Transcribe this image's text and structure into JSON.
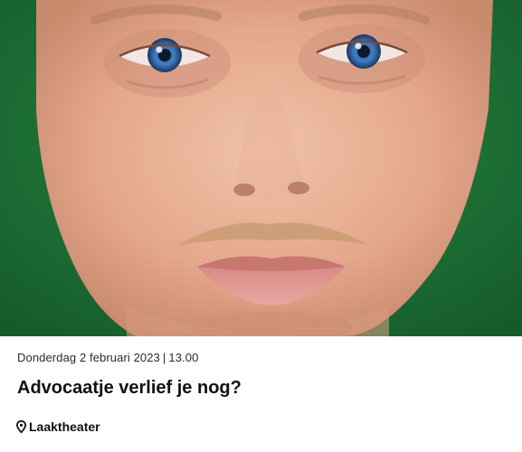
{
  "event": {
    "image_alt": "Portret van een man met blauwe ogen en snor voor een groene achtergrond",
    "date": "Donderdag 2 februari 2023",
    "separator": "|",
    "time": "13.00",
    "title": "Advocaatje verlief je nog?",
    "venue": "Laaktheater",
    "venue_icon": "map-pin-icon"
  },
  "colors": {
    "background_green": "#1e7a3a",
    "text": "#111111",
    "meta_text": "#2b2b2b"
  }
}
